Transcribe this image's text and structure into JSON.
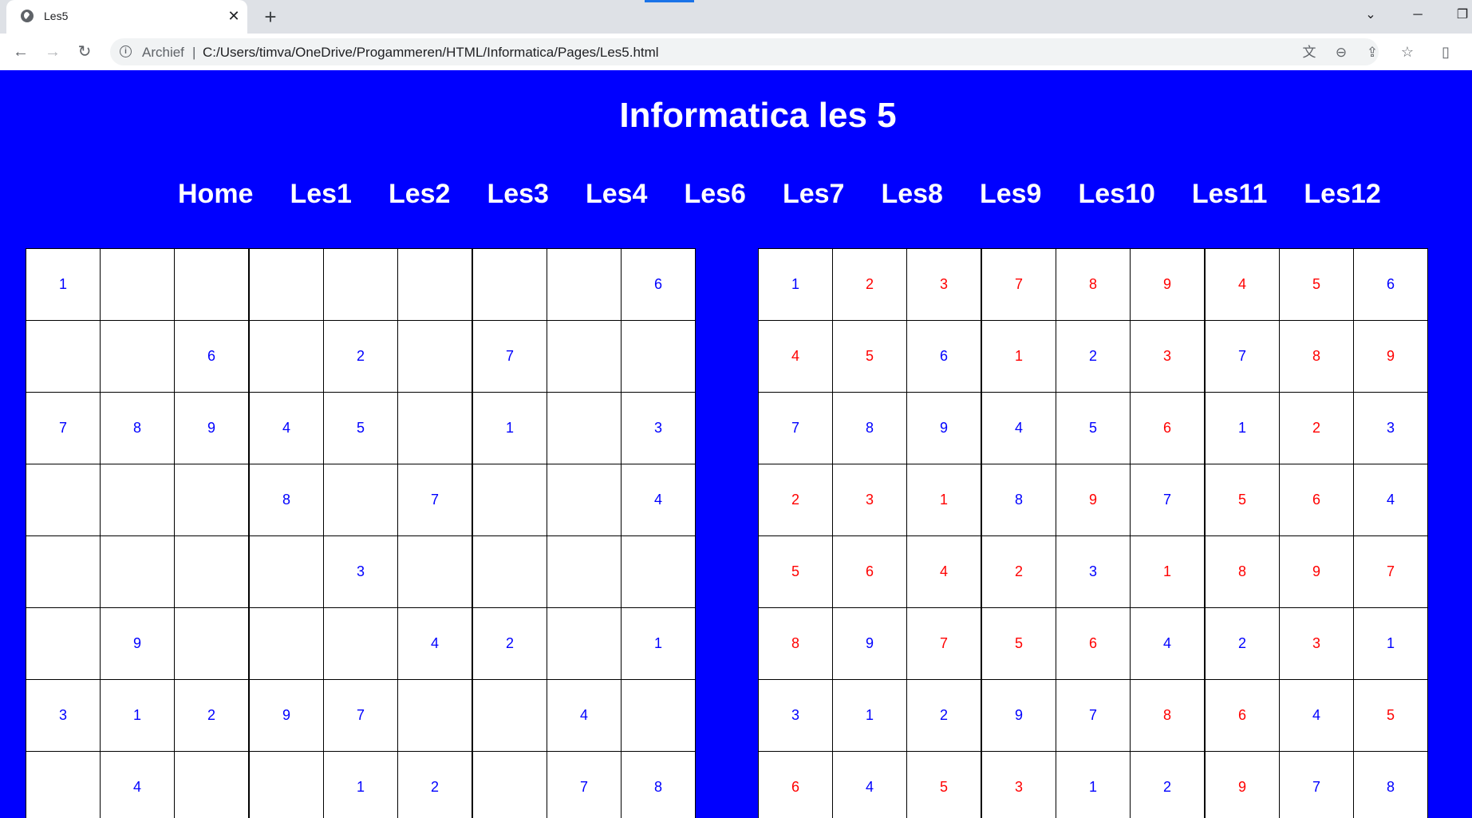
{
  "browser": {
    "tab_title": "Les5",
    "tab_close": "✕",
    "new_tab": "+",
    "address_scheme_label": "Archief",
    "address_separator": "|",
    "url": "C:/Users/timva/OneDrive/Progammeren/HTML/Informatica/Pages/Les5.html",
    "icons": [
      "globe-icon",
      "close-icon",
      "plus-icon",
      "chevron-down-icon",
      "minimize-icon",
      "restore-icon",
      "back-icon",
      "forward-icon",
      "reload-icon",
      "info-icon",
      "translate-icon",
      "zoom-out-icon",
      "share-icon",
      "star-icon",
      "side-panel-icon"
    ]
  },
  "page": {
    "title": "Informatica les 5",
    "nav": [
      "Home",
      "Les1",
      "Les2",
      "Les3",
      "Les4",
      "Les6",
      "Les7",
      "Les8",
      "Les9",
      "Les10",
      "Les11",
      "Les12"
    ]
  },
  "colors": {
    "background": "#0000ff",
    "given_digit": "#0000ff",
    "filled_digit": "#ff0000"
  },
  "puzzle": [
    [
      "1",
      "",
      "",
      "",
      "",
      "",
      "",
      "",
      "6"
    ],
    [
      "",
      "",
      "6",
      "",
      "2",
      "",
      "7",
      "",
      ""
    ],
    [
      "7",
      "8",
      "9",
      "4",
      "5",
      "",
      "1",
      "",
      "3"
    ],
    [
      "",
      "",
      "",
      "8",
      "",
      "7",
      "",
      "",
      "4"
    ],
    [
      "",
      "",
      "",
      "",
      "3",
      "",
      "",
      "",
      ""
    ],
    [
      "",
      "9",
      "",
      "",
      "",
      "4",
      "2",
      "",
      "1"
    ],
    [
      "3",
      "1",
      "2",
      "9",
      "7",
      "",
      "",
      "4",
      ""
    ],
    [
      "",
      "4",
      "",
      "",
      "1",
      "2",
      "",
      "7",
      "8"
    ]
  ],
  "solution": [
    [
      "1",
      "2",
      "3",
      "7",
      "8",
      "9",
      "4",
      "5",
      "6"
    ],
    [
      "4",
      "5",
      "6",
      "1",
      "2",
      "3",
      "7",
      "8",
      "9"
    ],
    [
      "7",
      "8",
      "9",
      "4",
      "5",
      "6",
      "1",
      "2",
      "3"
    ],
    [
      "2",
      "3",
      "1",
      "8",
      "9",
      "7",
      "5",
      "6",
      "4"
    ],
    [
      "5",
      "6",
      "4",
      "2",
      "3",
      "1",
      "8",
      "9",
      "7"
    ],
    [
      "8",
      "9",
      "7",
      "5",
      "6",
      "4",
      "2",
      "3",
      "1"
    ],
    [
      "3",
      "1",
      "2",
      "9",
      "7",
      "8",
      "6",
      "4",
      "5"
    ],
    [
      "6",
      "4",
      "5",
      "3",
      "1",
      "2",
      "9",
      "7",
      "8"
    ]
  ]
}
